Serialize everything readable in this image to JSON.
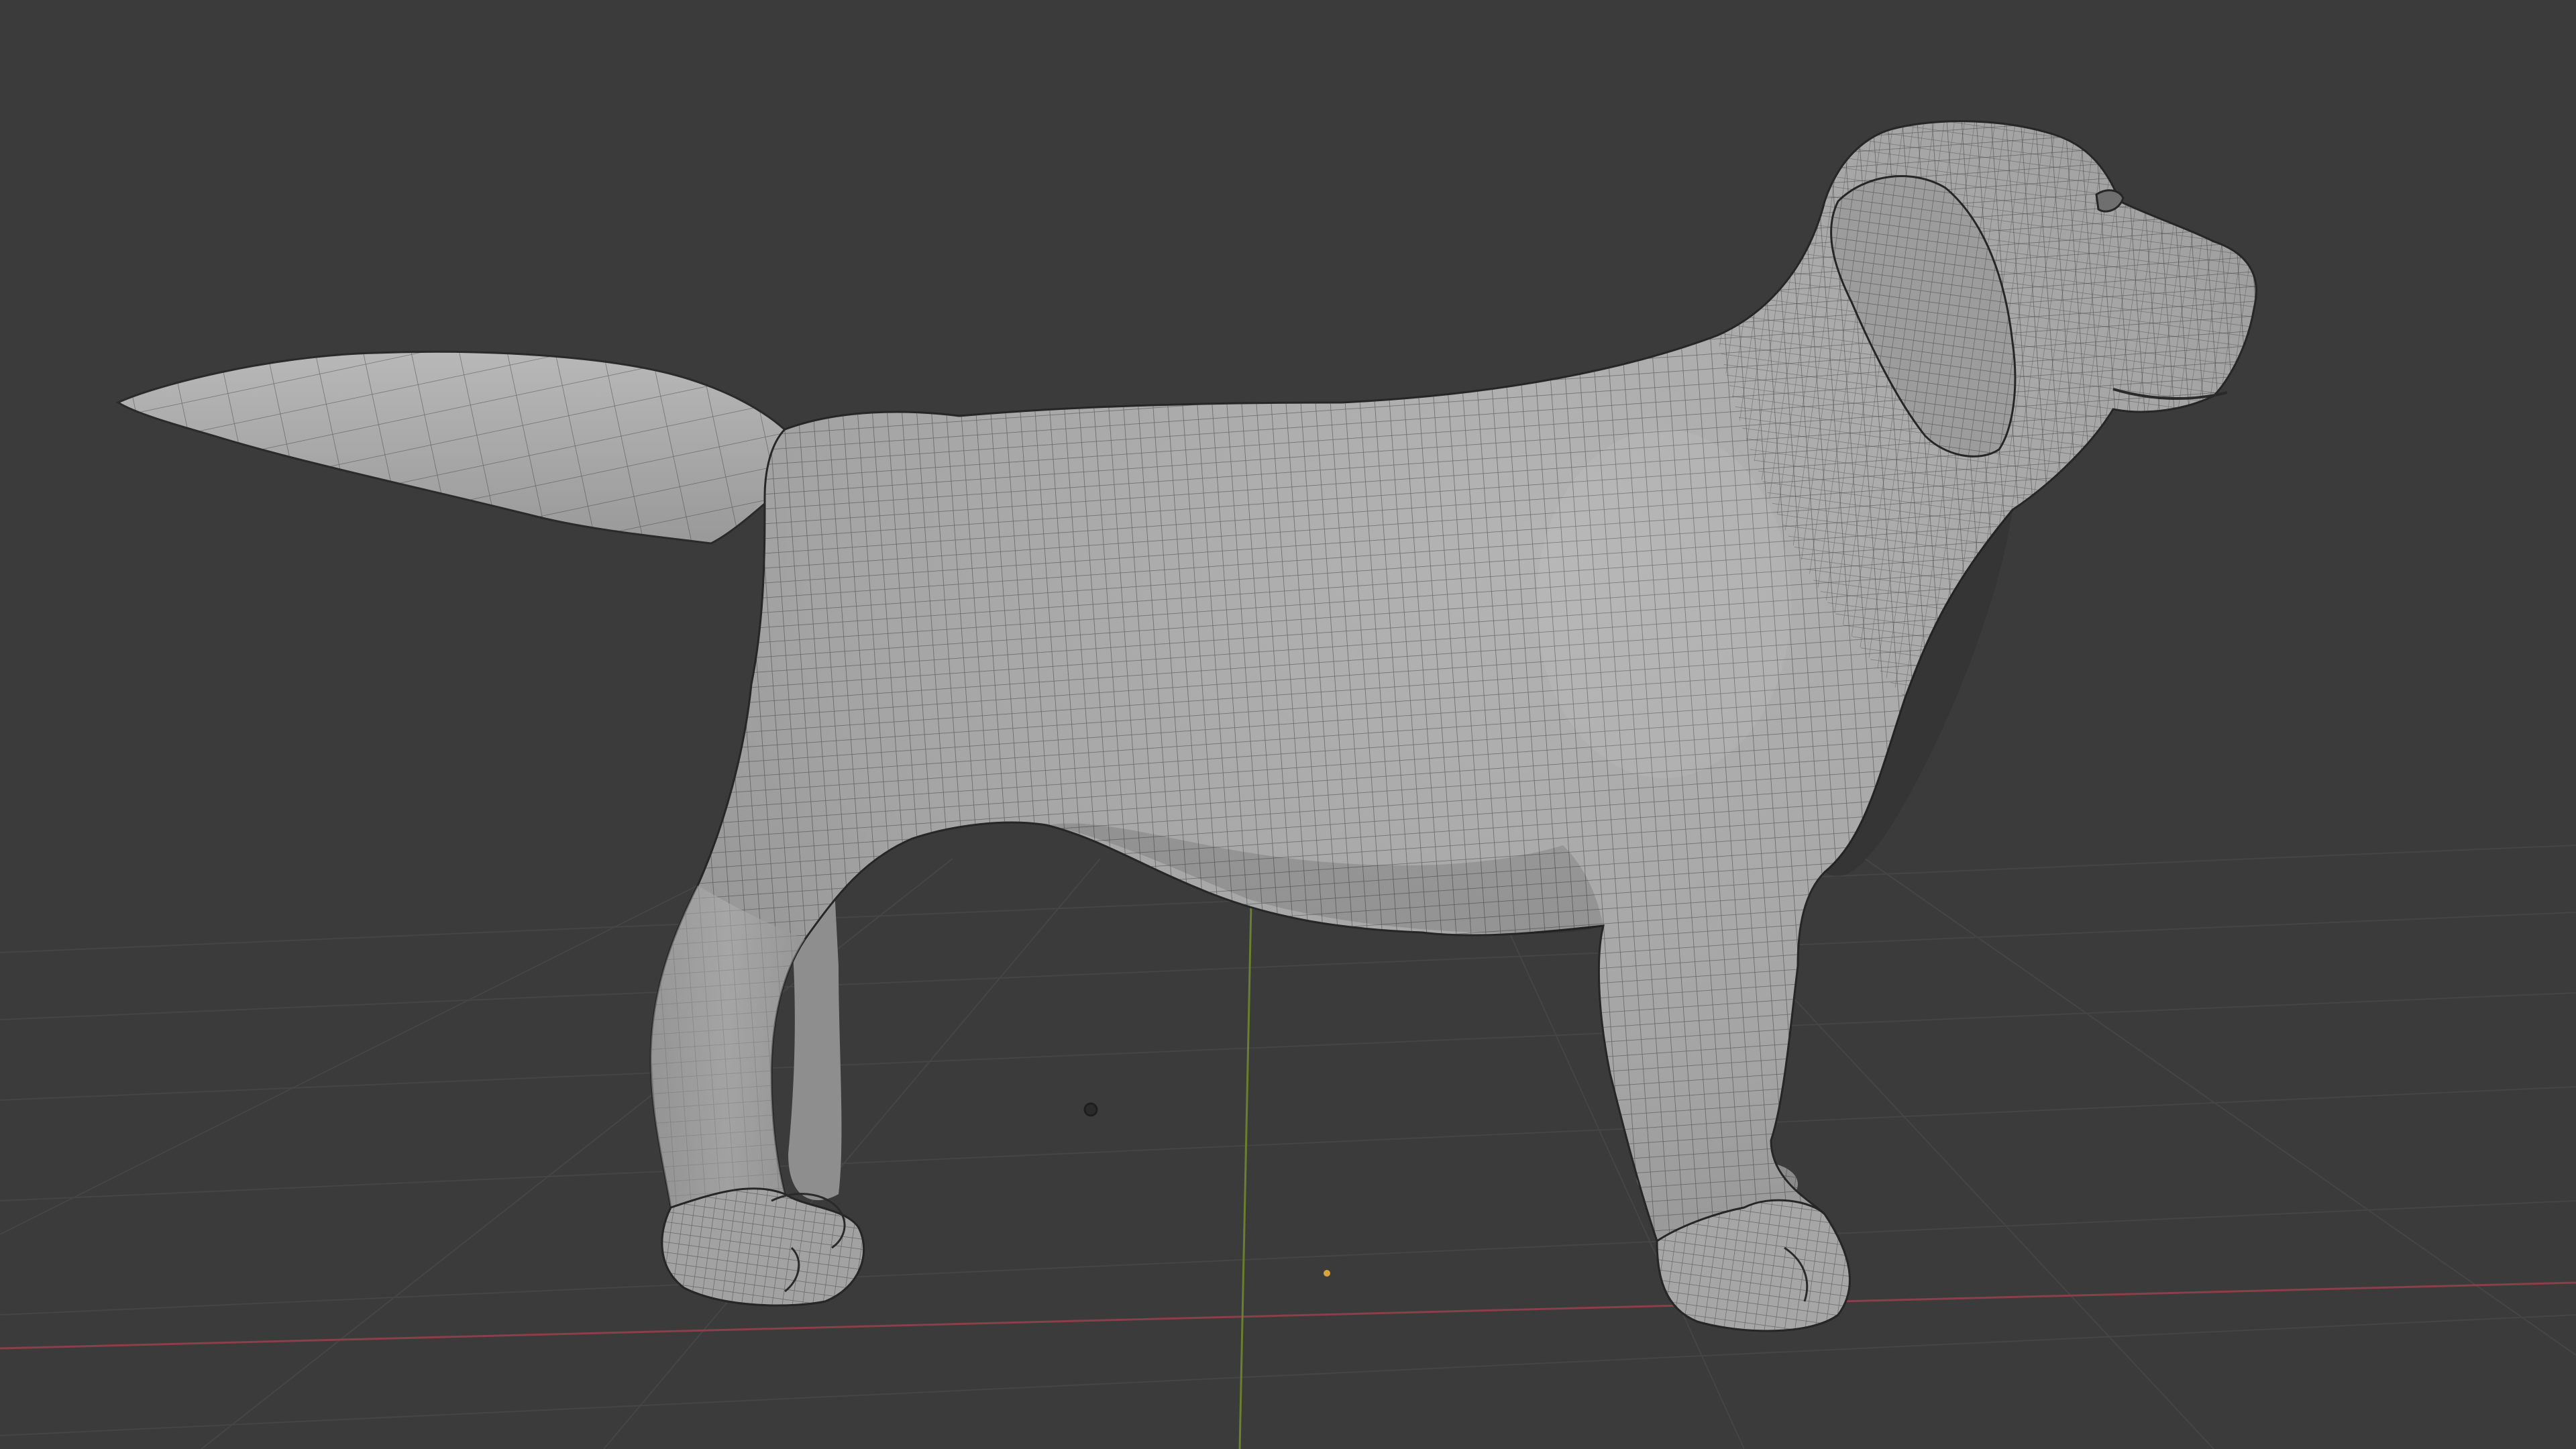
{
  "viewport": {
    "mode": "3D viewport",
    "background_color": "#3b3b3b",
    "grid_line_color": "#454545",
    "x_axis_color": "#8a3f4a",
    "y_axis_color": "#6b7f2e",
    "model": {
      "name": "dog-base-mesh",
      "shading": "solid-with-wireframe",
      "surface_color": "#a9a9a9",
      "wire_color": "#2f2f2f"
    }
  }
}
